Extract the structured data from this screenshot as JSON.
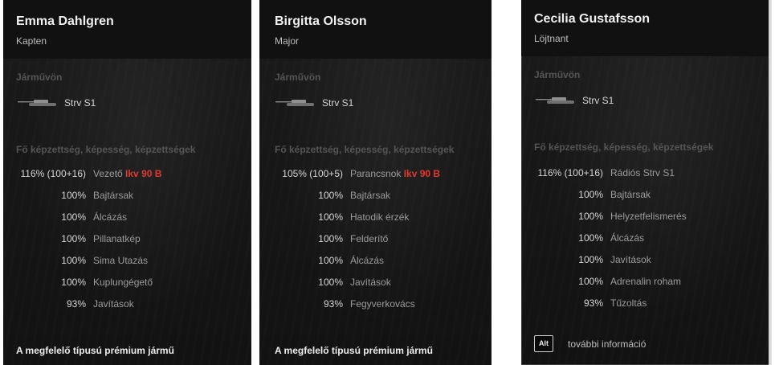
{
  "cards": [
    {
      "name": "Emma Dahlgren",
      "rank": "Kapten",
      "vehicle_section": "Járművön",
      "vehicle": "Strv S1",
      "skills_section": "Fő képzettség, képesség, képzettségek",
      "skills": [
        {
          "pct": "116% (100+16)",
          "label": "Vezető",
          "vehicle": "Ikv 90 B"
        },
        {
          "pct": "100%",
          "label": "Bajtársak"
        },
        {
          "pct": "100%",
          "label": "Álcázás"
        },
        {
          "pct": "100%",
          "label": "Pillanatkép"
        },
        {
          "pct": "100%",
          "label": "Sima Utazás"
        },
        {
          "pct": "100%",
          "label": "Kuplungégető"
        },
        {
          "pct": "93%",
          "label": "Javítások"
        }
      ],
      "premium_title": "A megfelelő típusú prémium jármű"
    },
    {
      "name": "Birgitta Olsson",
      "rank": "Major",
      "vehicle_section": "Járművön",
      "vehicle": "Strv S1",
      "skills_section": "Fő képzettség, képesség, képzettségek",
      "skills": [
        {
          "pct": "105% (100+5)",
          "label": "Parancsnok",
          "vehicle": "Ikv 90 B"
        },
        {
          "pct": "100%",
          "label": "Bajtársak"
        },
        {
          "pct": "100%",
          "label": "Hatodik érzék"
        },
        {
          "pct": "100%",
          "label": "Felderítő"
        },
        {
          "pct": "100%",
          "label": "Álcázás"
        },
        {
          "pct": "100%",
          "label": "Javítások"
        },
        {
          "pct": "93%",
          "label": "Fegyverkovács"
        }
      ],
      "premium_title": "A megfelelő típusú prémium jármű"
    },
    {
      "name": "Cecilia Gustafsson",
      "rank": "Löjtnant",
      "vehicle_section": "Járművön",
      "vehicle": "Strv S1",
      "skills_section": "Fő képzettség, képesség, képzettségek",
      "skills": [
        {
          "pct": "116% (100+16)",
          "label": "Rádiós Strv S1"
        },
        {
          "pct": "100%",
          "label": "Bajtársak"
        },
        {
          "pct": "100%",
          "label": "Helyzetfelismerés"
        },
        {
          "pct": "100%",
          "label": "Álcázás"
        },
        {
          "pct": "100%",
          "label": "Javítások"
        },
        {
          "pct": "100%",
          "label": "Adrenalin roham"
        },
        {
          "pct": "93%",
          "label": "Tűzoltás"
        }
      ],
      "alt_key": "Alt",
      "more_info": "további információ"
    }
  ],
  "colors": {
    "accent_red": "#e03a2f",
    "panel_bg": "#141414",
    "heading": "#555555"
  },
  "icons": [
    "tank-icon",
    "alt-key-icon"
  ]
}
